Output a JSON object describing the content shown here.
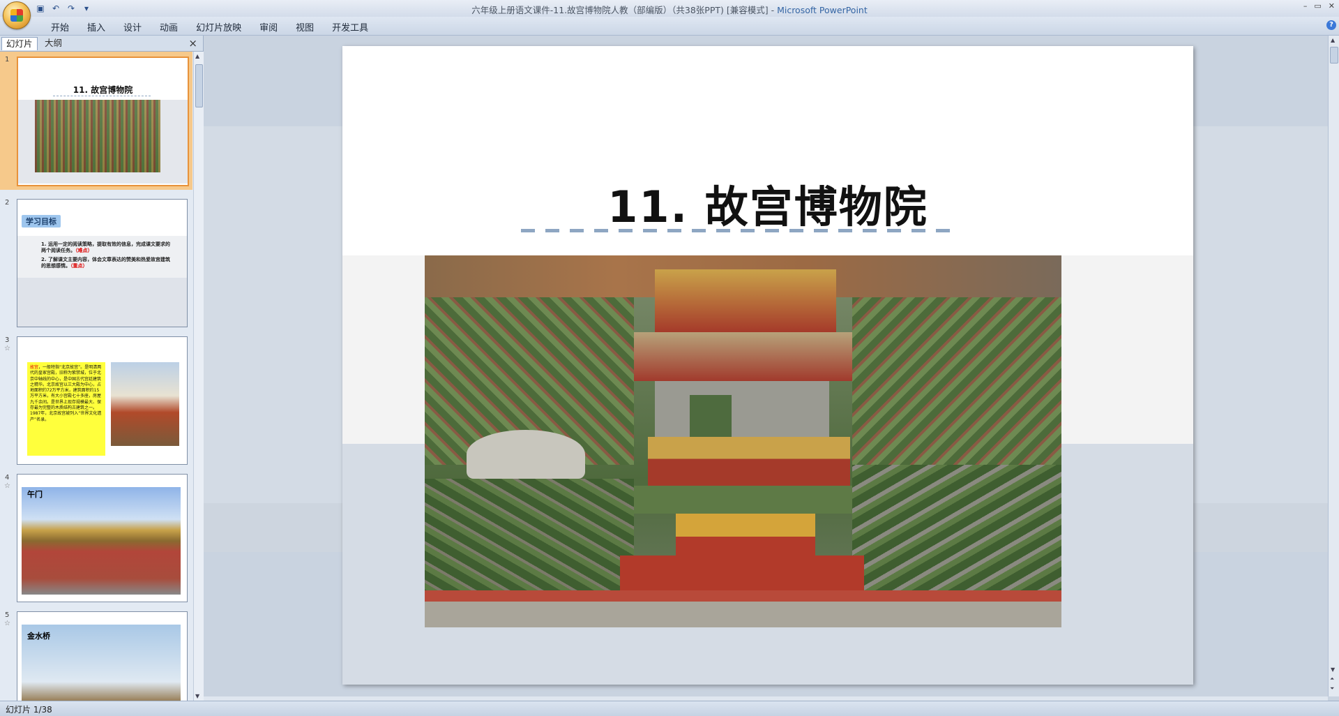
{
  "window": {
    "title": "六年级上册语文课件-11.故宫博物院人教（部编版）（共38张PPT) [兼容模式] - ",
    "app_name": "Microsoft PowerPoint"
  },
  "ribbon": {
    "tabs": [
      "开始",
      "插入",
      "设计",
      "动画",
      "幻灯片放映",
      "审阅",
      "视图",
      "开发工具"
    ]
  },
  "panel": {
    "tab_slides": "幻灯片",
    "tab_outline": "大纲",
    "close_glyph": "×"
  },
  "thumbnails": [
    {
      "number": "1",
      "title": "11. 故宫博物院"
    },
    {
      "number": "2",
      "tag": "学习目标",
      "line1": "1. 运用一定的阅读策略，提取有效的信息，完成课文要求的两个阅读任务。",
      "line1_mark": "（难点）",
      "line2": "2. 了解课文主要内容，体会文章表达的赞美和热爱故宫建筑的思想感情。",
      "line2_mark": "（重点）"
    },
    {
      "number": "3",
      "text_lead": "故宫",
      "text": "，一般特指“北京故宫”。是明清两代的皇家宫殿，旧称为紫禁城，位于北京中轴线的中心，是中国古代宫廷建筑之精华。北京故宫以三大殿为中心，占地面积约72万平方米，建筑面积约15万平方米，有大小宫殿七十多座，房屋九千余间。是世界上现存规模最大、保存最为完整的木质结构古建筑之一。1987年，北京故宫被列入“世界文化遗产”名录。"
    },
    {
      "number": "4",
      "label": "午门"
    },
    {
      "number": "5",
      "label": "金水桥"
    }
  ],
  "slide": {
    "title": "11. 故宫博物院"
  },
  "status": {
    "slide_info": "幻灯片 1/38"
  },
  "colors": {
    "accent": "#3465a4",
    "selection": "#f6c98b",
    "dash": "#8ea6c2"
  }
}
